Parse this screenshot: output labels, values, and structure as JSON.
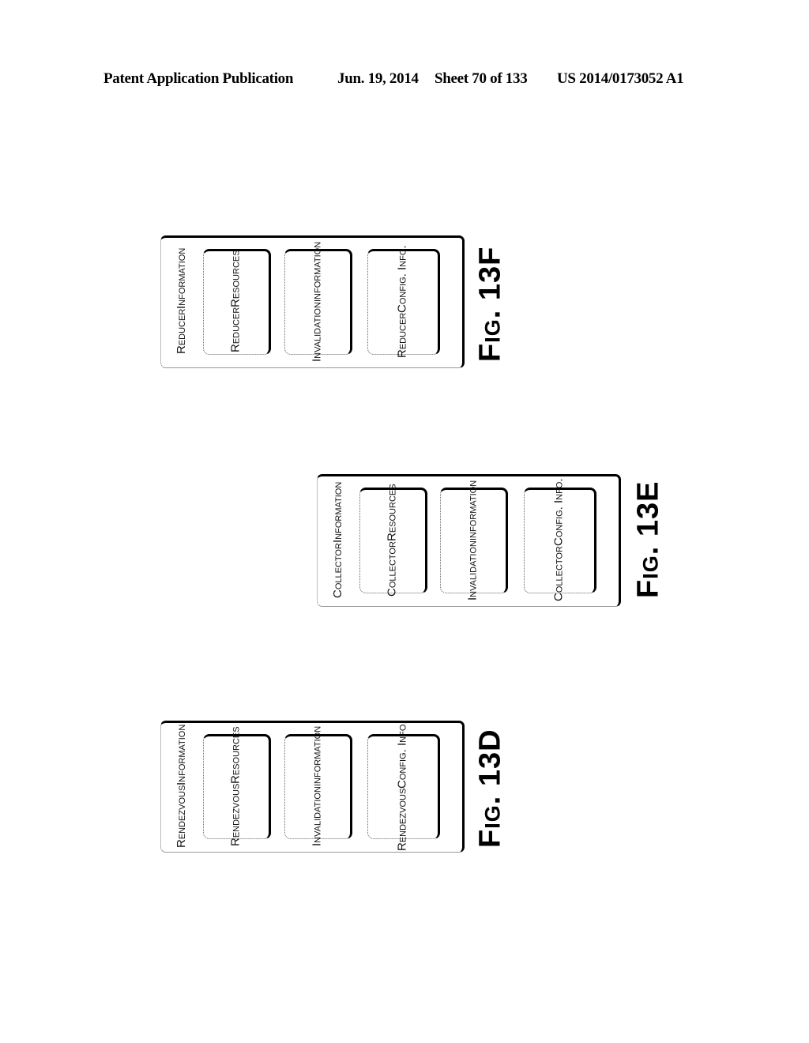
{
  "header": {
    "publication": "Patent Application Publication",
    "date": "Jun. 19, 2014",
    "sheet": "Sheet 70 of 133",
    "number": "US 2014/0173052 A1"
  },
  "figures": [
    {
      "id": "13F",
      "label": "Fig. 13F",
      "outer_title": [
        "Reducer",
        "Information"
      ],
      "boxes": [
        [
          "Reducer",
          "Resources"
        ],
        [
          "Invalidation",
          "information"
        ],
        [
          "Reducer",
          "Config. Info."
        ]
      ]
    },
    {
      "id": "13E",
      "label": "Fig. 13E",
      "outer_title": [
        "Collector",
        "Information"
      ],
      "boxes": [
        [
          "Collector",
          "Resources"
        ],
        [
          "Invalidation",
          "information"
        ],
        [
          "Collector",
          "Config. Info."
        ]
      ]
    },
    {
      "id": "13D",
      "label": "Fig. 13D",
      "outer_title": [
        "Rendezvous",
        "Information"
      ],
      "boxes": [
        [
          "Rendezvous",
          "Resources"
        ],
        [
          "Invalidation",
          "information"
        ],
        [
          "Rendezvous",
          "Config. Info."
        ]
      ]
    }
  ]
}
